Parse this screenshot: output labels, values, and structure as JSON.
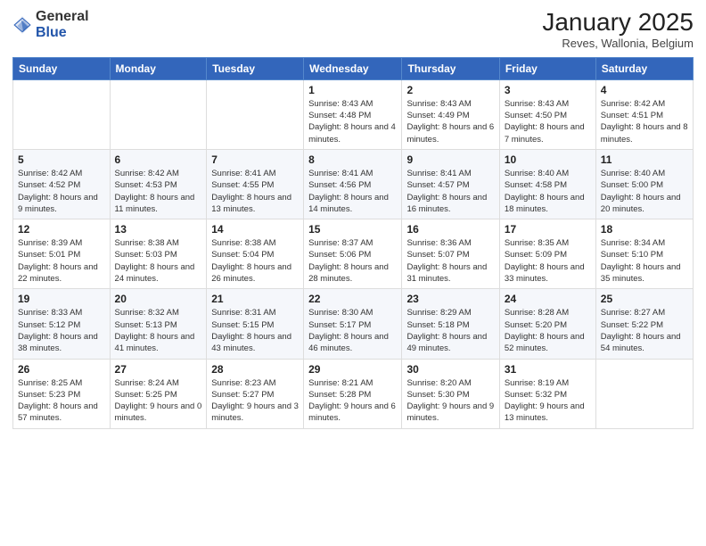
{
  "logo": {
    "general": "General",
    "blue": "Blue"
  },
  "header": {
    "title": "January 2025",
    "subtitle": "Reves, Wallonia, Belgium"
  },
  "weekdays": [
    "Sunday",
    "Monday",
    "Tuesday",
    "Wednesday",
    "Thursday",
    "Friday",
    "Saturday"
  ],
  "weeks": [
    [
      {
        "day": "",
        "info": ""
      },
      {
        "day": "",
        "info": ""
      },
      {
        "day": "",
        "info": ""
      },
      {
        "day": "1",
        "info": "Sunrise: 8:43 AM\nSunset: 4:48 PM\nDaylight: 8 hours\nand 4 minutes."
      },
      {
        "day": "2",
        "info": "Sunrise: 8:43 AM\nSunset: 4:49 PM\nDaylight: 8 hours\nand 6 minutes."
      },
      {
        "day": "3",
        "info": "Sunrise: 8:43 AM\nSunset: 4:50 PM\nDaylight: 8 hours\nand 7 minutes."
      },
      {
        "day": "4",
        "info": "Sunrise: 8:42 AM\nSunset: 4:51 PM\nDaylight: 8 hours\nand 8 minutes."
      }
    ],
    [
      {
        "day": "5",
        "info": "Sunrise: 8:42 AM\nSunset: 4:52 PM\nDaylight: 8 hours\nand 9 minutes."
      },
      {
        "day": "6",
        "info": "Sunrise: 8:42 AM\nSunset: 4:53 PM\nDaylight: 8 hours\nand 11 minutes."
      },
      {
        "day": "7",
        "info": "Sunrise: 8:41 AM\nSunset: 4:55 PM\nDaylight: 8 hours\nand 13 minutes."
      },
      {
        "day": "8",
        "info": "Sunrise: 8:41 AM\nSunset: 4:56 PM\nDaylight: 8 hours\nand 14 minutes."
      },
      {
        "day": "9",
        "info": "Sunrise: 8:41 AM\nSunset: 4:57 PM\nDaylight: 8 hours\nand 16 minutes."
      },
      {
        "day": "10",
        "info": "Sunrise: 8:40 AM\nSunset: 4:58 PM\nDaylight: 8 hours\nand 18 minutes."
      },
      {
        "day": "11",
        "info": "Sunrise: 8:40 AM\nSunset: 5:00 PM\nDaylight: 8 hours\nand 20 minutes."
      }
    ],
    [
      {
        "day": "12",
        "info": "Sunrise: 8:39 AM\nSunset: 5:01 PM\nDaylight: 8 hours\nand 22 minutes."
      },
      {
        "day": "13",
        "info": "Sunrise: 8:38 AM\nSunset: 5:03 PM\nDaylight: 8 hours\nand 24 minutes."
      },
      {
        "day": "14",
        "info": "Sunrise: 8:38 AM\nSunset: 5:04 PM\nDaylight: 8 hours\nand 26 minutes."
      },
      {
        "day": "15",
        "info": "Sunrise: 8:37 AM\nSunset: 5:06 PM\nDaylight: 8 hours\nand 28 minutes."
      },
      {
        "day": "16",
        "info": "Sunrise: 8:36 AM\nSunset: 5:07 PM\nDaylight: 8 hours\nand 31 minutes."
      },
      {
        "day": "17",
        "info": "Sunrise: 8:35 AM\nSunset: 5:09 PM\nDaylight: 8 hours\nand 33 minutes."
      },
      {
        "day": "18",
        "info": "Sunrise: 8:34 AM\nSunset: 5:10 PM\nDaylight: 8 hours\nand 35 minutes."
      }
    ],
    [
      {
        "day": "19",
        "info": "Sunrise: 8:33 AM\nSunset: 5:12 PM\nDaylight: 8 hours\nand 38 minutes."
      },
      {
        "day": "20",
        "info": "Sunrise: 8:32 AM\nSunset: 5:13 PM\nDaylight: 8 hours\nand 41 minutes."
      },
      {
        "day": "21",
        "info": "Sunrise: 8:31 AM\nSunset: 5:15 PM\nDaylight: 8 hours\nand 43 minutes."
      },
      {
        "day": "22",
        "info": "Sunrise: 8:30 AM\nSunset: 5:17 PM\nDaylight: 8 hours\nand 46 minutes."
      },
      {
        "day": "23",
        "info": "Sunrise: 8:29 AM\nSunset: 5:18 PM\nDaylight: 8 hours\nand 49 minutes."
      },
      {
        "day": "24",
        "info": "Sunrise: 8:28 AM\nSunset: 5:20 PM\nDaylight: 8 hours\nand 52 minutes."
      },
      {
        "day": "25",
        "info": "Sunrise: 8:27 AM\nSunset: 5:22 PM\nDaylight: 8 hours\nand 54 minutes."
      }
    ],
    [
      {
        "day": "26",
        "info": "Sunrise: 8:25 AM\nSunset: 5:23 PM\nDaylight: 8 hours\nand 57 minutes."
      },
      {
        "day": "27",
        "info": "Sunrise: 8:24 AM\nSunset: 5:25 PM\nDaylight: 9 hours\nand 0 minutes."
      },
      {
        "day": "28",
        "info": "Sunrise: 8:23 AM\nSunset: 5:27 PM\nDaylight: 9 hours\nand 3 minutes."
      },
      {
        "day": "29",
        "info": "Sunrise: 8:21 AM\nSunset: 5:28 PM\nDaylight: 9 hours\nand 6 minutes."
      },
      {
        "day": "30",
        "info": "Sunrise: 8:20 AM\nSunset: 5:30 PM\nDaylight: 9 hours\nand 9 minutes."
      },
      {
        "day": "31",
        "info": "Sunrise: 8:19 AM\nSunset: 5:32 PM\nDaylight: 9 hours\nand 13 minutes."
      },
      {
        "day": "",
        "info": ""
      }
    ]
  ]
}
